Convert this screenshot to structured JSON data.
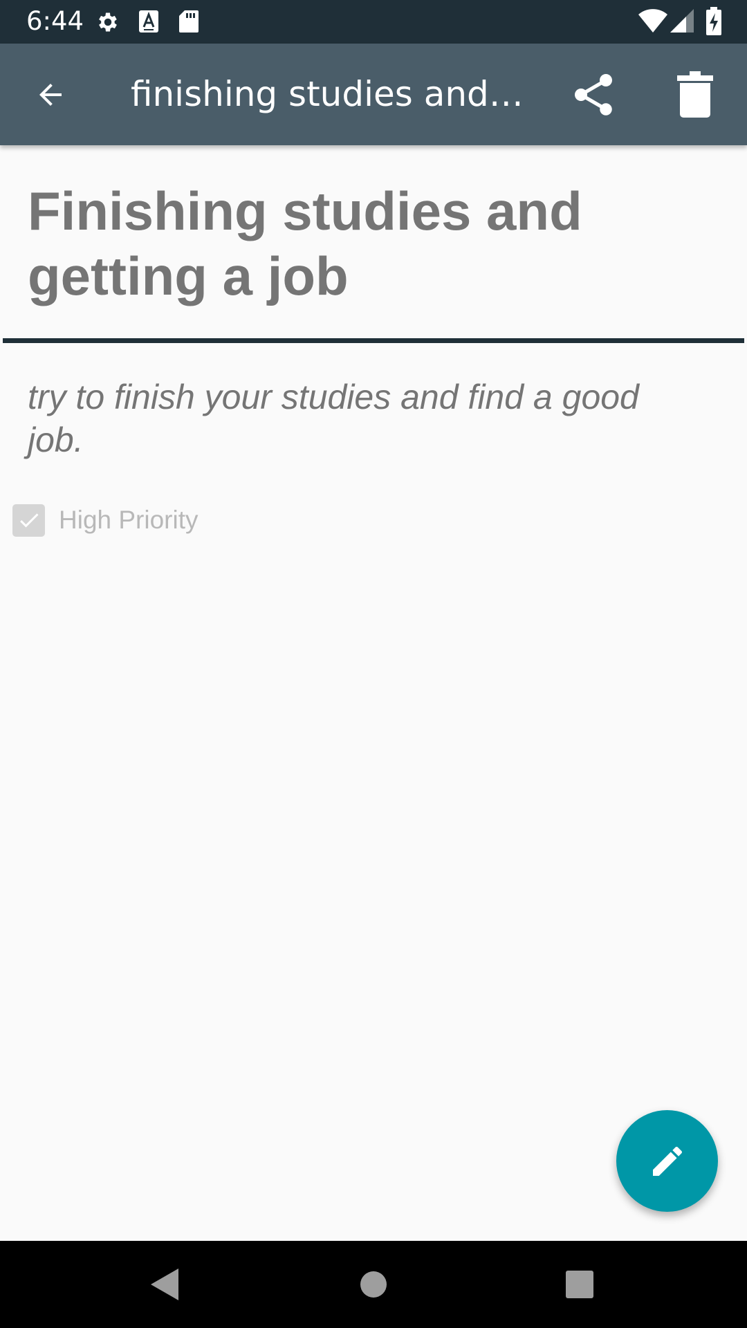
{
  "status_bar": {
    "time": "6:44",
    "icons": [
      "settings-icon",
      "font-a-icon",
      "sd-card-icon",
      "wifi-icon",
      "cell-signal-icon",
      "battery-charging-icon"
    ]
  },
  "app_bar": {
    "title": "finishing studies and g…",
    "back_icon": "arrow-back-icon",
    "share_icon": "share-icon",
    "delete_icon": "trash-icon",
    "background_color": "#4a5d69"
  },
  "note": {
    "title_line1": "Finishing studies and",
    "title_line2": "getting a job",
    "body_line1": "try to finish your studies and find a good",
    "body_line2": "job.",
    "priority_label": "High Priority",
    "high_priority": true
  },
  "fab": {
    "icon": "edit-pencil-icon",
    "color": "#0097a7"
  },
  "nav_bar": {
    "icons": [
      "back-triangle-icon",
      "home-circle-icon",
      "recents-square-icon"
    ]
  }
}
